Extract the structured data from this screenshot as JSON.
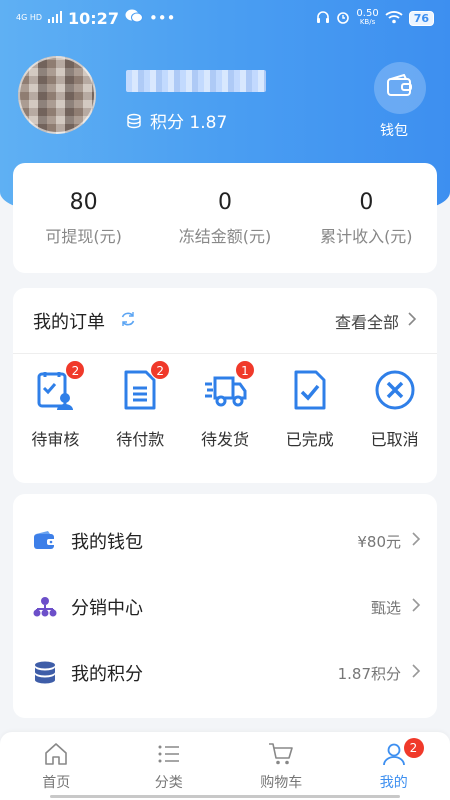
{
  "status_bar": {
    "network": "4G HD",
    "time": "10:27",
    "speed": "0.50",
    "speed_unit": "KB/s",
    "battery": "76"
  },
  "profile": {
    "points_label": "积分 1.87",
    "wallet_label": "钱包"
  },
  "stats": [
    {
      "value": "80",
      "label": "可提现(元)"
    },
    {
      "value": "0",
      "label": "冻结金额(元)"
    },
    {
      "value": "0",
      "label": "累计收入(元)"
    }
  ],
  "orders": {
    "title": "我的订单",
    "view_all": "查看全部",
    "items": [
      {
        "label": "待审核",
        "icon": "clipboard-user-icon",
        "badge": "2"
      },
      {
        "label": "待付款",
        "icon": "document-icon",
        "badge": "2"
      },
      {
        "label": "待发货",
        "icon": "truck-icon",
        "badge": "1"
      },
      {
        "label": "已完成",
        "icon": "document-check-icon",
        "badge": ""
      },
      {
        "label": "已取消",
        "icon": "cancel-circle-icon",
        "badge": ""
      }
    ]
  },
  "menu": [
    {
      "label": "我的钱包",
      "value": "¥80元",
      "icon": "wallet-icon"
    },
    {
      "label": "分销中心",
      "value": "甄选",
      "icon": "hierarchy-icon"
    },
    {
      "label": "我的积分",
      "value": "1.87积分",
      "icon": "database-icon"
    }
  ],
  "tabbar": {
    "items": [
      {
        "label": "首页",
        "icon": "home-icon"
      },
      {
        "label": "分类",
        "icon": "list-icon"
      },
      {
        "label": "购物车",
        "icon": "cart-icon"
      },
      {
        "label": "我的",
        "icon": "user-icon",
        "badge": "2"
      }
    ],
    "active_index": 3
  },
  "colors": {
    "accent": "#3d8ff0",
    "badge": "#f0392a"
  }
}
